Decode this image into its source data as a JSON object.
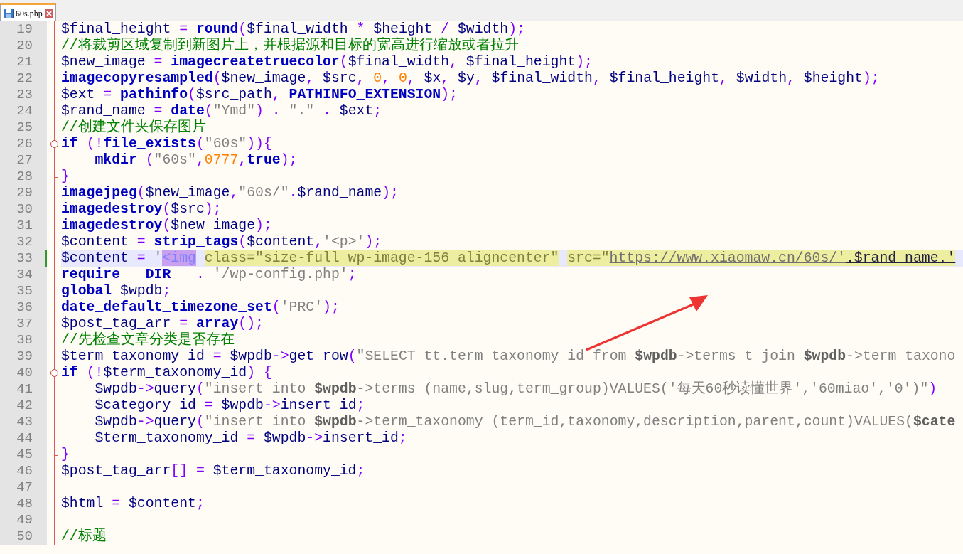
{
  "tabs": [
    {
      "label": "60s.php",
      "selected": true
    }
  ],
  "lines": [
    {
      "number": "19",
      "tokens": [
        {
          "kind": "var",
          "text": "$final_height "
        },
        {
          "kind": "op",
          "text": "= "
        },
        {
          "kind": "func",
          "text": "round"
        },
        {
          "kind": "op",
          "text": "("
        },
        {
          "kind": "var",
          "text": "$final_width "
        },
        {
          "kind": "op",
          "text": "* "
        },
        {
          "kind": "var",
          "text": "$height "
        },
        {
          "kind": "op",
          "text": "/ "
        },
        {
          "kind": "var",
          "text": "$width"
        },
        {
          "kind": "op",
          "text": ");"
        }
      ]
    },
    {
      "number": "20",
      "tokens": [
        {
          "kind": "comment",
          "text": "//将裁剪区域复制到新图片上，并根据源和目标的宽高进行缩放或者拉升"
        }
      ]
    },
    {
      "number": "21",
      "tokens": [
        {
          "kind": "var",
          "text": "$new_image "
        },
        {
          "kind": "op",
          "text": "= "
        },
        {
          "kind": "func",
          "text": "imagecreatetruecolor"
        },
        {
          "kind": "op",
          "text": "("
        },
        {
          "kind": "var",
          "text": "$final_width"
        },
        {
          "kind": "op",
          "text": ", "
        },
        {
          "kind": "var",
          "text": "$final_height"
        },
        {
          "kind": "op",
          "text": ");"
        }
      ]
    },
    {
      "number": "22",
      "tokens": [
        {
          "kind": "func",
          "text": "imagecopyresampled"
        },
        {
          "kind": "op",
          "text": "("
        },
        {
          "kind": "var",
          "text": "$new_image"
        },
        {
          "kind": "op",
          "text": ", "
        },
        {
          "kind": "var",
          "text": "$src"
        },
        {
          "kind": "op",
          "text": ", "
        },
        {
          "kind": "num",
          "text": "0"
        },
        {
          "kind": "op",
          "text": ", "
        },
        {
          "kind": "num",
          "text": "0"
        },
        {
          "kind": "op",
          "text": ", "
        },
        {
          "kind": "var",
          "text": "$x"
        },
        {
          "kind": "op",
          "text": ", "
        },
        {
          "kind": "var",
          "text": "$y"
        },
        {
          "kind": "op",
          "text": ", "
        },
        {
          "kind": "var",
          "text": "$final_width"
        },
        {
          "kind": "op",
          "text": ", "
        },
        {
          "kind": "var",
          "text": "$final_height"
        },
        {
          "kind": "op",
          "text": ", "
        },
        {
          "kind": "var",
          "text": "$width"
        },
        {
          "kind": "op",
          "text": ", "
        },
        {
          "kind": "var",
          "text": "$height"
        },
        {
          "kind": "op",
          "text": ");"
        }
      ]
    },
    {
      "number": "23",
      "tokens": [
        {
          "kind": "var",
          "text": "$ext "
        },
        {
          "kind": "op",
          "text": "= "
        },
        {
          "kind": "func",
          "text": "pathinfo"
        },
        {
          "kind": "op",
          "text": "("
        },
        {
          "kind": "var",
          "text": "$src_path"
        },
        {
          "kind": "op",
          "text": ", "
        },
        {
          "kind": "func",
          "text": "PATHINFO_EXTENSION"
        },
        {
          "kind": "op",
          "text": ");"
        }
      ]
    },
    {
      "number": "24",
      "tokens": [
        {
          "kind": "var",
          "text": "$rand_name "
        },
        {
          "kind": "op",
          "text": "= "
        },
        {
          "kind": "func",
          "text": "date"
        },
        {
          "kind": "op",
          "text": "("
        },
        {
          "kind": "str",
          "text": "\"Ymd\""
        },
        {
          "kind": "op",
          "text": ") . "
        },
        {
          "kind": "str",
          "text": "\".\""
        },
        {
          "kind": "op",
          "text": " . "
        },
        {
          "kind": "var",
          "text": "$ext"
        },
        {
          "kind": "op",
          "text": ";"
        }
      ]
    },
    {
      "number": "25",
      "tokens": [
        {
          "kind": "comment",
          "text": "//创建文件夹保存图片"
        }
      ]
    },
    {
      "number": "26",
      "kind": "fold-start",
      "tokens": [
        {
          "kind": "func",
          "text": "if "
        },
        {
          "kind": "op",
          "text": "(!"
        },
        {
          "kind": "func",
          "text": "file_exists"
        },
        {
          "kind": "op",
          "text": "("
        },
        {
          "kind": "str",
          "text": "\"60s\""
        },
        {
          "kind": "op",
          "text": ")){"
        }
      ]
    },
    {
      "number": "27",
      "tokens": [
        {
          "kind": "func",
          "text": "    mkdir "
        },
        {
          "kind": "op",
          "text": "("
        },
        {
          "kind": "str",
          "text": "\"60s\""
        },
        {
          "kind": "op",
          "text": ","
        },
        {
          "kind": "num",
          "text": "0777"
        },
        {
          "kind": "op",
          "text": ","
        },
        {
          "kind": "func",
          "text": "true"
        },
        {
          "kind": "op",
          "text": ");"
        }
      ]
    },
    {
      "number": "28",
      "kind": "fold-end",
      "tokens": [
        {
          "kind": "op",
          "text": "}"
        }
      ]
    },
    {
      "number": "29",
      "tokens": [
        {
          "kind": "func",
          "text": "imagejpeg"
        },
        {
          "kind": "op",
          "text": "("
        },
        {
          "kind": "var",
          "text": "$new_image"
        },
        {
          "kind": "op",
          "text": ","
        },
        {
          "kind": "str",
          "text": "\"60s/\""
        },
        {
          "kind": "op",
          "text": "."
        },
        {
          "kind": "var",
          "text": "$rand_name"
        },
        {
          "kind": "op",
          "text": ");"
        }
      ]
    },
    {
      "number": "30",
      "tokens": [
        {
          "kind": "func",
          "text": "imagedestroy"
        },
        {
          "kind": "op",
          "text": "("
        },
        {
          "kind": "var",
          "text": "$src"
        },
        {
          "kind": "op",
          "text": ");"
        }
      ]
    },
    {
      "number": "31",
      "tokens": [
        {
          "kind": "func",
          "text": "imagedestroy"
        },
        {
          "kind": "op",
          "text": "("
        },
        {
          "kind": "var",
          "text": "$new_image"
        },
        {
          "kind": "op",
          "text": ");"
        }
      ]
    },
    {
      "number": "32",
      "tokens": [
        {
          "kind": "var",
          "text": "$content "
        },
        {
          "kind": "op",
          "text": "= "
        },
        {
          "kind": "func",
          "text": "strip_tags"
        },
        {
          "kind": "op",
          "text": "("
        },
        {
          "kind": "var",
          "text": "$content"
        },
        {
          "kind": "op",
          "text": ","
        },
        {
          "kind": "str",
          "text": "'<p>'"
        },
        {
          "kind": "op",
          "text": ");"
        }
      ]
    },
    {
      "number": "33",
      "current": true,
      "changed": true,
      "tokens": [
        {
          "kind": "var",
          "text": "$content "
        },
        {
          "kind": "op",
          "text": "= "
        },
        {
          "kind": "str",
          "text": "'"
        },
        {
          "kind": "tag",
          "text": "<img"
        },
        {
          "kind": "attr",
          "text": "class=\"size-full wp-image-156 aligncenter\""
        },
        {
          "kind": "attr",
          "text": "src=\""
        },
        {
          "kind": "url",
          "text": "https://www.xiaomaw.cn/60s/'"
        },
        {
          "kind": "urlvar",
          "text": ".$rand_name.'"
        }
      ]
    },
    {
      "number": "34",
      "tokens": [
        {
          "kind": "func",
          "text": "require "
        },
        {
          "kind": "func",
          "text": "__DIR__ "
        },
        {
          "kind": "op",
          "text": ". "
        },
        {
          "kind": "str",
          "text": "'/wp-config.php'"
        },
        {
          "kind": "op",
          "text": ";"
        }
      ]
    },
    {
      "number": "35",
      "tokens": [
        {
          "kind": "func",
          "text": "global "
        },
        {
          "kind": "var",
          "text": "$wpdb"
        },
        {
          "kind": "op",
          "text": ";"
        }
      ]
    },
    {
      "number": "36",
      "tokens": [
        {
          "kind": "func",
          "text": "date_default_timezone_set"
        },
        {
          "kind": "op",
          "text": "("
        },
        {
          "kind": "str",
          "text": "'PRC'"
        },
        {
          "kind": "op",
          "text": ");"
        }
      ]
    },
    {
      "number": "37",
      "tokens": [
        {
          "kind": "var",
          "text": "$post_tag_arr "
        },
        {
          "kind": "op",
          "text": "= "
        },
        {
          "kind": "func",
          "text": "array"
        },
        {
          "kind": "op",
          "text": "();"
        }
      ]
    },
    {
      "number": "38",
      "tokens": [
        {
          "kind": "comment",
          "text": "//先检查文章分类是否存在"
        }
      ]
    },
    {
      "number": "39",
      "tokens": [
        {
          "kind": "var",
          "text": "$term_taxonomy_id "
        },
        {
          "kind": "op",
          "text": "= "
        },
        {
          "kind": "var",
          "text": "$wpdb"
        },
        {
          "kind": "op",
          "text": "->"
        },
        {
          "kind": "var",
          "text": "get_row"
        },
        {
          "kind": "op",
          "text": "("
        },
        {
          "kind": "str",
          "text": "\"SELECT tt.term_taxonomy_id from "
        },
        {
          "kind": "strvar",
          "text": "$wpdb"
        },
        {
          "kind": "str",
          "text": "->terms t join "
        },
        {
          "kind": "strvar",
          "text": "$wpdb"
        },
        {
          "kind": "str",
          "text": "->term_taxono"
        }
      ]
    },
    {
      "number": "40",
      "kind": "fold-start",
      "tokens": [
        {
          "kind": "func",
          "text": "if "
        },
        {
          "kind": "op",
          "text": "(!"
        },
        {
          "kind": "var",
          "text": "$term_taxonomy_id"
        },
        {
          "kind": "op",
          "text": ") {"
        }
      ]
    },
    {
      "number": "41",
      "tokens": [
        {
          "kind": "var",
          "text": "    $wpdb"
        },
        {
          "kind": "op",
          "text": "->"
        },
        {
          "kind": "var",
          "text": "query"
        },
        {
          "kind": "op",
          "text": "("
        },
        {
          "kind": "str",
          "text": "\"insert into "
        },
        {
          "kind": "strvar",
          "text": "$wpdb"
        },
        {
          "kind": "str",
          "text": "->terms (name,slug,term_group)VALUES('每天60秒读懂世界','60miao','0')\""
        },
        {
          "kind": "op",
          "text": ")"
        }
      ]
    },
    {
      "number": "42",
      "tokens": [
        {
          "kind": "var",
          "text": "    $category_id "
        },
        {
          "kind": "op",
          "text": "= "
        },
        {
          "kind": "var",
          "text": "$wpdb"
        },
        {
          "kind": "op",
          "text": "->"
        },
        {
          "kind": "var",
          "text": "insert_id"
        },
        {
          "kind": "op",
          "text": ";"
        }
      ]
    },
    {
      "number": "43",
      "tokens": [
        {
          "kind": "var",
          "text": "    $wpdb"
        },
        {
          "kind": "op",
          "text": "->"
        },
        {
          "kind": "var",
          "text": "query"
        },
        {
          "kind": "op",
          "text": "("
        },
        {
          "kind": "str",
          "text": "\"insert into "
        },
        {
          "kind": "strvar",
          "text": "$wpdb"
        },
        {
          "kind": "str",
          "text": "->term_taxonomy (term_id,taxonomy,description,parent,count)VALUES("
        },
        {
          "kind": "strvar",
          "text": "$cate"
        }
      ]
    },
    {
      "number": "44",
      "tokens": [
        {
          "kind": "var",
          "text": "    $term_taxonomy_id "
        },
        {
          "kind": "op",
          "text": "= "
        },
        {
          "kind": "var",
          "text": "$wpdb"
        },
        {
          "kind": "op",
          "text": "->"
        },
        {
          "kind": "var",
          "text": "insert_id"
        },
        {
          "kind": "op",
          "text": ";"
        }
      ]
    },
    {
      "number": "45",
      "kind": "fold-end",
      "tokens": [
        {
          "kind": "op",
          "text": "}"
        }
      ]
    },
    {
      "number": "46",
      "tokens": [
        {
          "kind": "var",
          "text": "$post_tag_arr"
        },
        {
          "kind": "op",
          "text": "[] = "
        },
        {
          "kind": "var",
          "text": "$term_taxonomy_id"
        },
        {
          "kind": "op",
          "text": ";"
        }
      ]
    },
    {
      "number": "47"
    },
    {
      "number": "48",
      "tokens": [
        {
          "kind": "var",
          "text": "$html "
        },
        {
          "kind": "op",
          "text": "= "
        },
        {
          "kind": "var",
          "text": "$content"
        },
        {
          "kind": "op",
          "text": ";"
        }
      ]
    },
    {
      "number": "49"
    },
    {
      "number": "50",
      "tokens": [
        {
          "kind": "comment",
          "text": "//标题"
        }
      ]
    }
  ]
}
